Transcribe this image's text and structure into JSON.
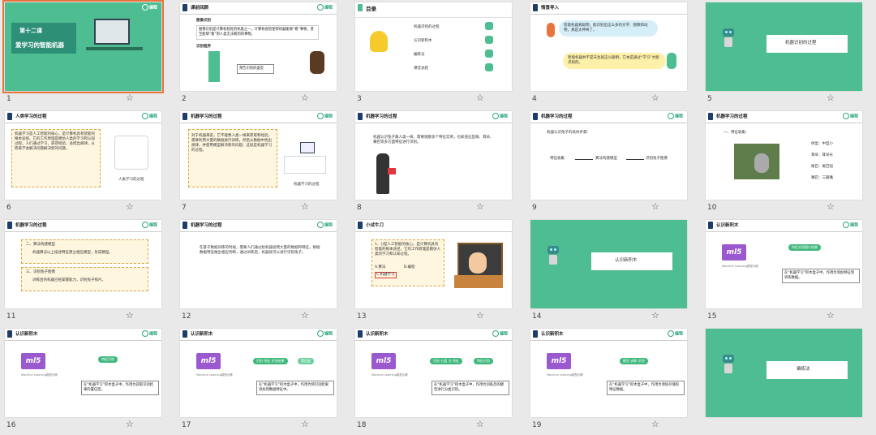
{
  "brand": {
    "logo_text": "编程"
  },
  "slides": [
    {
      "num": "1",
      "title_line1": "第十二课",
      "title_line2": "爱学习的智能机器"
    },
    {
      "num": "2",
      "header": "课前回顾",
      "sub1": "图像识别",
      "p1": "图像识别是计算机视觉的机能之一，计算机视觉使得机器能够“看”事物，甚至能够“看”到人类无法看到的事物。",
      "sub2": "识别程序",
      "hint": "预告识别的类型"
    },
    {
      "num": "3",
      "header": "目录",
      "items": [
        "机器识别的过程",
        "认识新积木",
        "编练法",
        "课堂总结"
      ]
    },
    {
      "num": "4",
      "header": "情景导入",
      "bubble1": "智能机器真聪明，能识别出这么多的文字、图像和动物，真是太神奇了。",
      "bubble2": "智能机器并不是天生就这么聪明，它本是通过“学习”才能识别的。"
    },
    {
      "num": "5",
      "banner": "机器识别的过程"
    },
    {
      "num": "6",
      "header": "人类学习的过程",
      "body": "机器学习是人工智能的核心，是计算机具有智能的根本途径。它的工作原理是模仿人类的学习和认知过程。人们通过学习，获得经验，总结出规律，从而来学会解决问题解决新的问题。",
      "caption": "人类学习的过程"
    },
    {
      "num": "7",
      "header": "机器学习的过程",
      "body": "对于机器来说，它不能像人类一样来获取和经验，需要利用大量的数据进行训练，然后从数据中找出规律，并使用模型解决新的问题，这就是机器学习的过程。",
      "caption": "机器学习的过程"
    },
    {
      "num": "8",
      "header": "机器学习的过程",
      "body": "机器认识兔子跟人类一样，需要观察多个特征实例，也知道这些眼、耳朵、嘴巴等多方面特征进行识别。"
    },
    {
      "num": "9",
      "header": "机器学习的过程",
      "intro": "机器认识兔子的具体步骤：",
      "steps": [
        "特征收集",
        "算法构建模型",
        "识别兔子图像"
      ]
    },
    {
      "num": "10",
      "header": "机器学习的过程",
      "step": "一、特征收集：",
      "features": [
        "体型：中型小",
        "耳朵：耳朵长",
        "尾巴：尾巴短",
        "嘴巴：三瓣嘴"
      ]
    },
    {
      "num": "11",
      "header": "机器学习的过程",
      "s2": "二、算法构建模型",
      "s2b": "机器算法以上描述特征建立相应模型，形成模型。",
      "s3": "三、识别兔子图像",
      "s3b": "训练后的机器已经掌握能力，识别兔子照片。"
    },
    {
      "num": "12",
      "header": "机器学习的过程",
      "body": "在基于数据训练的时候，需要人们通过给机器投喂大量的数据和特征，根据数据特征做出相应判断，通过训练后，机器就可以进行识别兔子。"
    },
    {
      "num": "13",
      "header": "小试牛刀",
      "q": "1．()是人工智能的核心，是计算机具有智能的根本途径，它的工作原理是模仿人类的学习和认知过程。",
      "opts": [
        "A.算法",
        "B.编程",
        "C.机器学习"
      ]
    },
    {
      "num": "14",
      "banner": "认识新积木"
    },
    {
      "num": "15",
      "header": "认识新积木",
      "block": "特征实现图片结果",
      "note": "在“机器学习”积木盒子中，作用为添加特征到训练数据。"
    },
    {
      "num": "16",
      "header": "认识新积木",
      "block": "特征识别",
      "note": "在“机器学习”积木盒子中，作用为获取识别结果的置信度。"
    },
    {
      "num": "17",
      "header": "认识新积木",
      "blocks": [
        "识别 特征 识别结果",
        "置信度"
      ],
      "note": "在“机器学习”积木盒子中，作用为将识别结果添加到数据特征中。"
    },
    {
      "num": "18",
      "header": "认识新积木",
      "blocks": [
        "识别 分类 为 特征",
        "特征识别"
      ],
      "note": "在“机器学习”积木盒子中，作用为训练后的模型进行分类识别。"
    },
    {
      "num": "19",
      "header": "认识新积木",
      "block": "模型 训练 识别",
      "note": "在“机器学习”积木盒子中，作用为清除存储的特征数据。"
    },
    {
      "num": "20",
      "banner": "编练法"
    }
  ],
  "ml_logo": "ml5",
  "ml_caption": "Machine Learning模型训练",
  "colors": {
    "teal": "#4ebd92",
    "navy": "#1d3d6b",
    "orange": "#e8743b",
    "red": "#e0373d"
  }
}
